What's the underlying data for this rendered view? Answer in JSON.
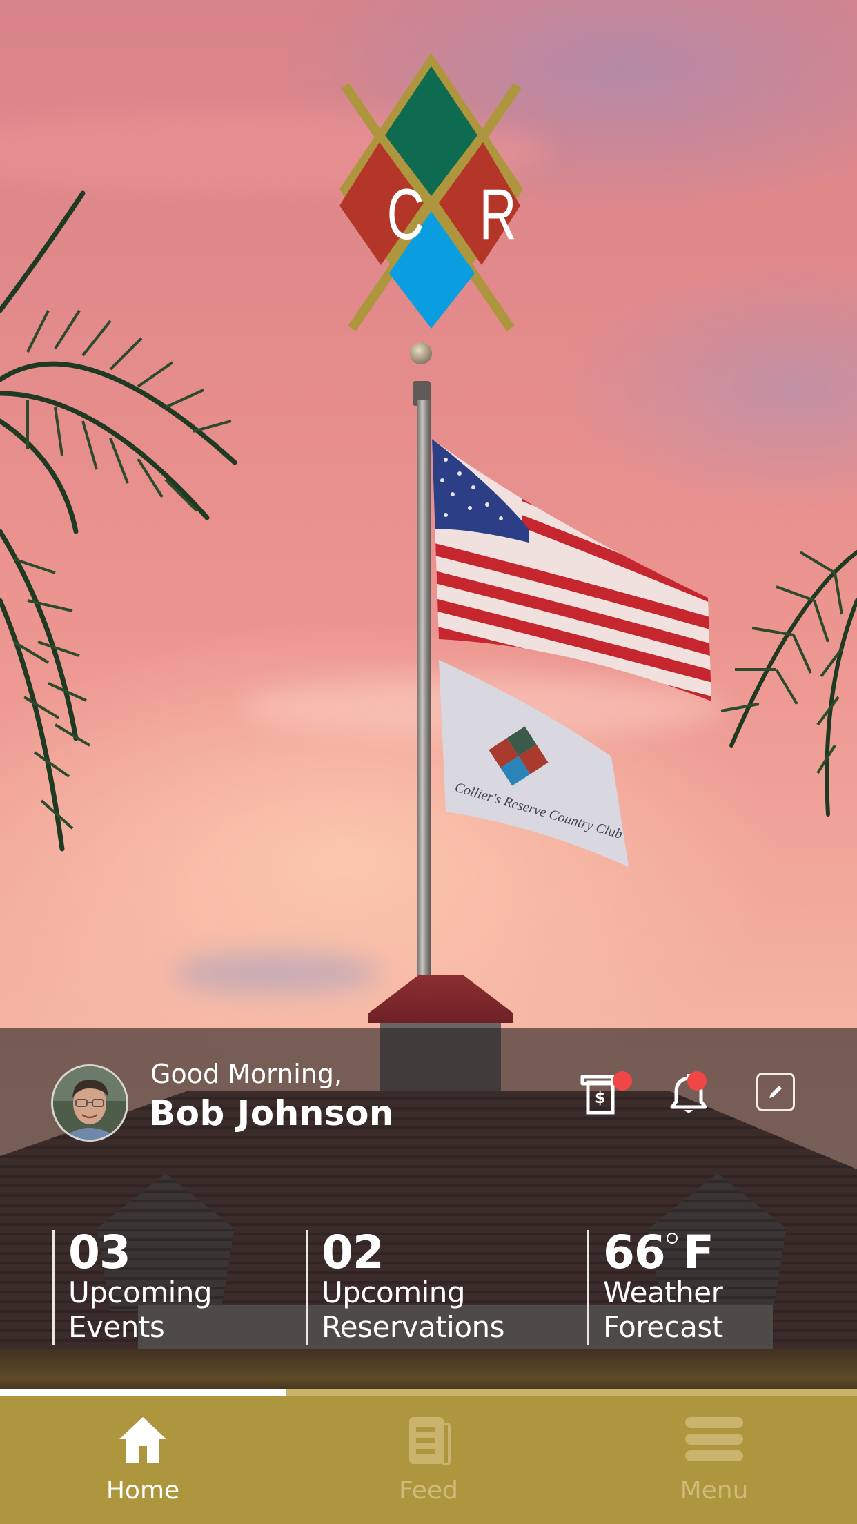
{
  "app": {
    "logo_letters": [
      "C",
      "R"
    ],
    "flag_text": "Collier's Reserve Country Club",
    "colors": {
      "accent_gold": "#ad963e",
      "logo_green": "#0f6b4f",
      "logo_red": "#b43628",
      "logo_blue": "#0aa0e0",
      "badge_red": "#f04646"
    }
  },
  "profile": {
    "greeting": "Good Morning,",
    "name": "Bob Johnson",
    "avatar_icon": "user-photo"
  },
  "header_actions": [
    {
      "name": "billing",
      "icon": "receipt-dollar-icon",
      "has_badge": true
    },
    {
      "name": "notifications",
      "icon": "bell-icon",
      "has_badge": true
    },
    {
      "name": "edit",
      "icon": "pencil-icon",
      "has_badge": false
    }
  ],
  "stats": [
    {
      "value": "03",
      "label_line1": "Upcoming",
      "label_line2": "Events"
    },
    {
      "value": "02",
      "label_line1": "Upcoming",
      "label_line2": "Reservations"
    },
    {
      "value": "66",
      "unit": "F",
      "label_line1": "Weather",
      "label_line2": "Forecast"
    }
  ],
  "page_indicator": {
    "progress_fraction": 0.333
  },
  "tabs": [
    {
      "label": "Home",
      "icon": "home-icon",
      "active": true
    },
    {
      "label": "Feed",
      "icon": "newspaper-icon",
      "active": false
    },
    {
      "label": "Menu",
      "icon": "hamburger-menu-icon",
      "active": false
    }
  ]
}
